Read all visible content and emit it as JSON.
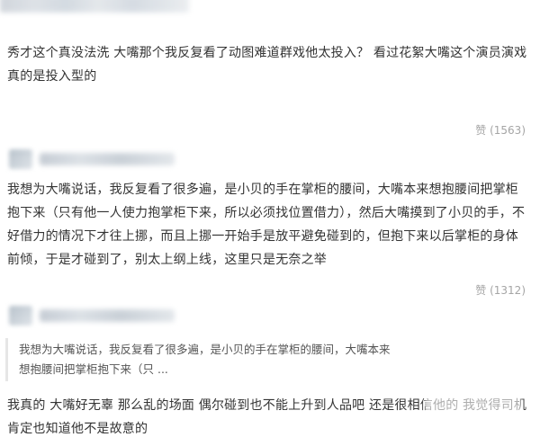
{
  "comments": [
    {
      "text": "秀才这个真没法洗 大嘴那个我反复看了动图难道群戏他太投入？ 看过花絮大嘴这个演员演戏真的是投入型的",
      "like_label": "赞 (1563)"
    },
    {
      "text": "我想为大嘴说话，我反复看了很多遍，是小贝的手在掌柜的腰间，大嘴本来想抱腰间把掌柜抱下来（只有他一人使力抱掌柜下来，所以必须找位置借力），然后大嘴摸到了小贝的手，不好借力的情况下才往上挪，而且上挪一开始手是放平避免碰到的，但抱下来以后掌柜的身体前倾，于是才碰到了，别太上纲上线，这里只是无奈之举",
      "like_label": "赞 (1312)"
    },
    {
      "quote": "我想为大嘴说话，我反复看了很多遍，是小贝的手在掌柜的腰间，大嘴本来想抱腰间把掌柜抱下来（只 ...",
      "text": "我真的 大嘴好无辜 那么乱的场面 偶尔碰到也不能上升到人品吧 还是很相信他的 我觉得司机肯定也知道他不是故意的"
    }
  ]
}
